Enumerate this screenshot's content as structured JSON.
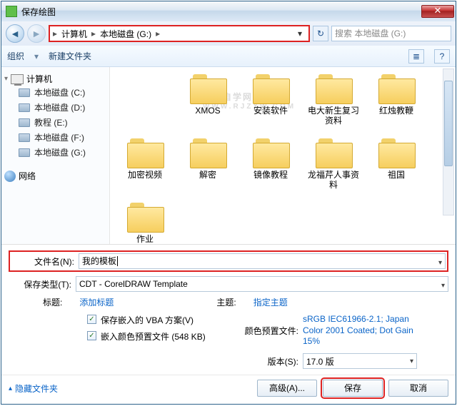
{
  "titlebar": {
    "title": "保存绘图"
  },
  "nav": {
    "breadcrumb": {
      "seg1": "计算机",
      "seg2": "本地磁盘 (G:)"
    },
    "search_placeholder": "搜索 本地磁盘 (G:)"
  },
  "toolbar": {
    "organize": "组织",
    "newfolder": "新建文件夹"
  },
  "sidebar": {
    "computer": "计算机",
    "drives": [
      "本地磁盘 (C:)",
      "本地磁盘 (D:)",
      "教程 (E:)",
      "本地磁盘 (F:)",
      "本地磁盘 (G:)"
    ],
    "network": "网络"
  },
  "files": [
    "XMOS",
    "安装软件",
    "电大新生复习资料",
    "红烛教鞭",
    "加密视频",
    "解密",
    "镜像教程",
    "龙福芹人事资料",
    "祖国",
    "作业"
  ],
  "watermark": {
    "main": "软件自学网",
    "sub": "WWW.RJZXW.COM"
  },
  "form": {
    "filename_label": "文件名(N):",
    "filename_value": "我的模板",
    "savetype_label": "保存类型(T):",
    "savetype_value": "CDT - CorelDRAW Template",
    "title_label": "标题:",
    "title_value": "添加标题",
    "theme_label": "主题:",
    "theme_value": "指定主题",
    "opt_vba": "保存嵌入的 VBA 方案(V)",
    "opt_icc": "嵌入颜色预置文件 (548 KB)",
    "color_label": "颜色预置文件:",
    "color_value": "sRGB IEC61966-2.1; Japan Color 2001 Coated; Dot Gain 15%",
    "version_label": "版本(S):",
    "version_value": "17.0 版"
  },
  "buttons": {
    "hide": "隐藏文件夹",
    "advanced": "高级(A)...",
    "save": "保存",
    "cancel": "取消"
  }
}
